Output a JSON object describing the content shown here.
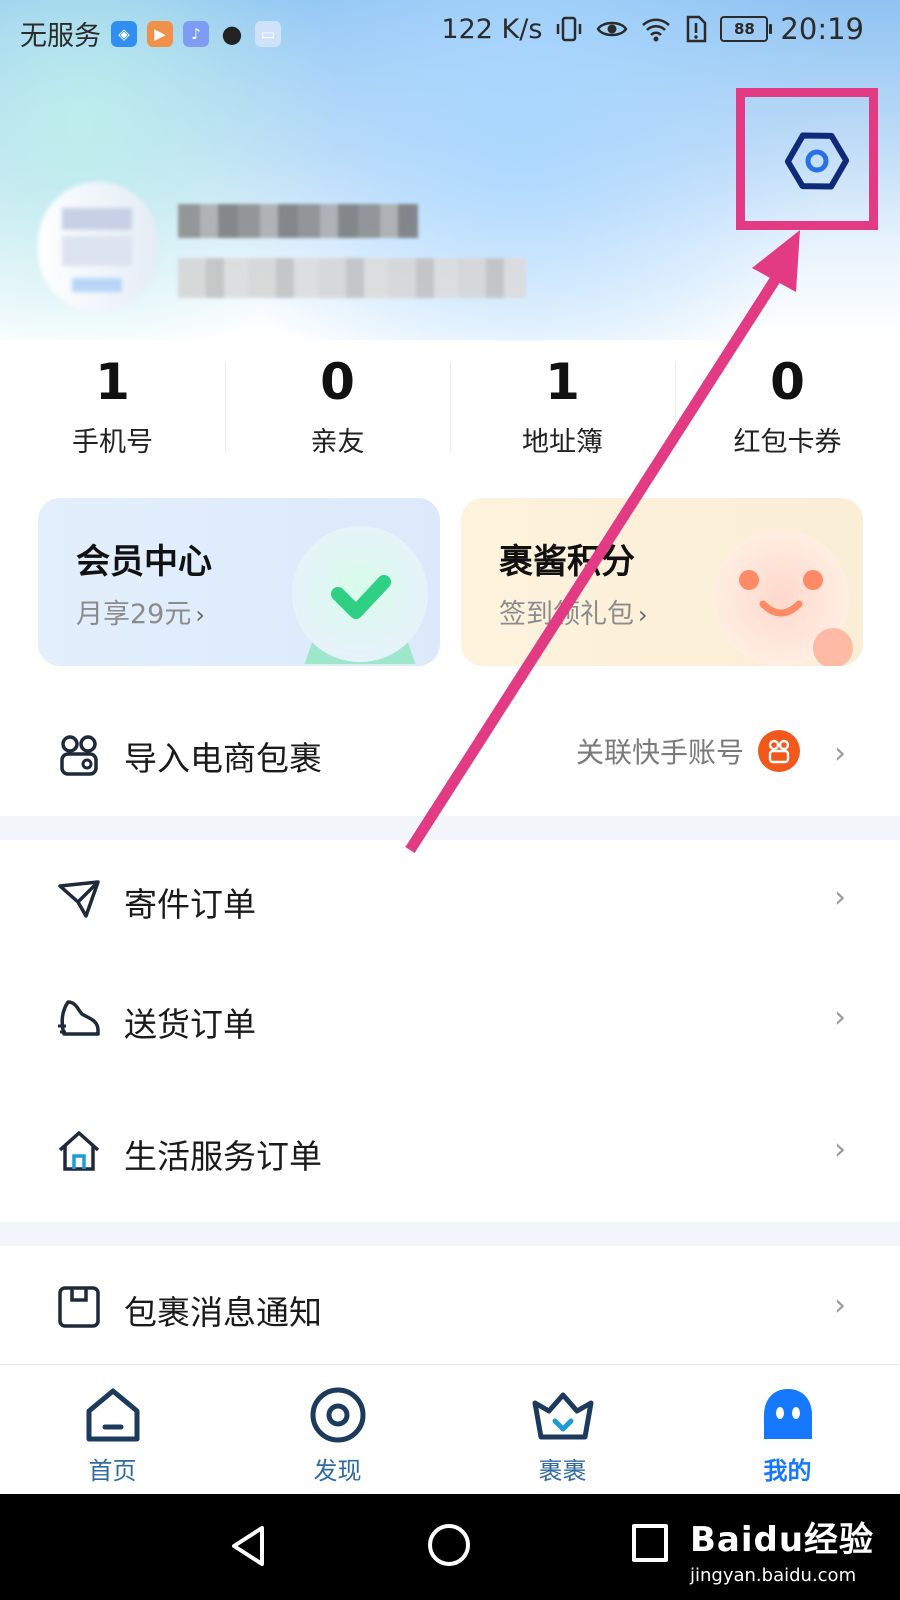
{
  "status_bar": {
    "carrier": "无服务",
    "speed": "122 K/s",
    "battery": "88",
    "time": "20:19"
  },
  "stats": [
    {
      "value": "1",
      "label": "手机号"
    },
    {
      "value": "0",
      "label": "亲友"
    },
    {
      "value": "1",
      "label": "地址簿"
    },
    {
      "value": "0",
      "label": "红包卡券"
    }
  ],
  "cards": {
    "member": {
      "title": "会员中心",
      "subtitle": "月享29元",
      "chevron": "›"
    },
    "points": {
      "title": "裹酱积分",
      "subtitle": "签到领礼包",
      "chevron": "›"
    }
  },
  "menu": {
    "import": {
      "label": "导入电商包裹",
      "extra": "关联快手账号",
      "chevron": "›"
    },
    "send_orders": {
      "label": "寄件订单",
      "chevron": "›"
    },
    "delivery_orders": {
      "label": "送货订单",
      "chevron": "›"
    },
    "life_orders": {
      "label": "生活服务订单",
      "chevron": "›"
    },
    "notify": {
      "label": "包裹消息通知",
      "chevron": "›"
    }
  },
  "bottom_nav": [
    {
      "label": "首页",
      "icon": "home-icon"
    },
    {
      "label": "发现",
      "icon": "discover-icon"
    },
    {
      "label": "裹裹",
      "icon": "crown-icon"
    },
    {
      "label": "我的",
      "icon": "profile-icon",
      "active": true
    }
  ],
  "watermark": {
    "main": "Baidu经验",
    "sub": "jingyan.baidu.com"
  },
  "colors": {
    "accent_blue": "#1677ff",
    "nav_blue": "#2f6aa0",
    "highlight_pink": "#e23b84",
    "kuaishou_orange": "#f2571c"
  }
}
